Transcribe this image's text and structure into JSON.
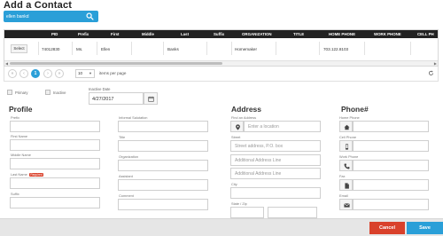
{
  "page_title": "Add a Contact",
  "search": {
    "value": "ellen bankd"
  },
  "grid": {
    "columns": [
      "PID",
      "Prefix",
      "First",
      "Middle",
      "Last",
      "Suffix",
      "ORGANIZATION",
      "TITLE",
      "HOME PHONE",
      "WORK PHONE",
      "CELL PH"
    ],
    "rows": [
      {
        "select_label": "Select",
        "pid": "74012830",
        "prefix": "Ms.",
        "first": "Ellen",
        "middle": "",
        "last": "Banks",
        "suffix": "",
        "organization": "Homemaker",
        "title": "",
        "home_phone": "703.122.8103",
        "work_phone": "",
        "cell_phone": ""
      }
    ]
  },
  "pager": {
    "current_page": "1",
    "page_size": "10",
    "items_per_page_label": "items per page"
  },
  "flags": {
    "primary_label": "Primary",
    "inactive_label": "Inactive",
    "inactive_date_label": "Inactive Date",
    "inactive_date_value": "4/27/2017"
  },
  "profile": {
    "title": "Profile",
    "prefix_label": "Prefix",
    "first_name_label": "First Name",
    "middle_name_label": "Middle Name",
    "last_name_label": "Last Name",
    "required_badge": "Required",
    "suffix_label": "Suffix",
    "informal_salutation_label": "Informal Salutation",
    "title_label": "Title",
    "organization_label": "Organization",
    "assistant_label": "Assistant",
    "comment_label": "Comment"
  },
  "address": {
    "title": "Address",
    "find_label": "Find an Address",
    "find_placeholder": "Enter a location",
    "street_label": "Street",
    "street_placeholder": "Street address, P.O. box",
    "additional_placeholder_1": "Additional Address Line",
    "additional_placeholder_2": "Additional Address Line",
    "city_label": "City",
    "state_zip_label": "State / Zip"
  },
  "phone": {
    "title": "Phone#",
    "home_label": "Home Phone",
    "cell_label": "Cell Phone",
    "work_label": "Work Phone",
    "fax_label": "Fax",
    "email_label": "Email"
  },
  "footer": {
    "cancel_label": "Cancel",
    "save_label": "Save"
  },
  "colors": {
    "accent": "#2a9fd8",
    "danger": "#d9412b",
    "header_bg": "#222222"
  }
}
